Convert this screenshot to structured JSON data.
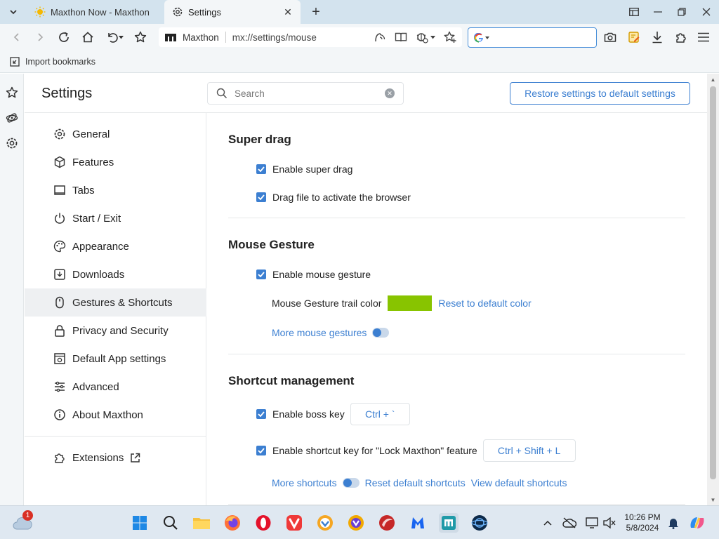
{
  "tabs": [
    {
      "title": "Maxthon Now - Maxthon",
      "active": false
    },
    {
      "title": "Settings",
      "active": true
    }
  ],
  "address": {
    "site": "Maxthon",
    "path": "mx://settings/mouse"
  },
  "search_engine": {
    "value": "",
    "icon": "google-icon"
  },
  "bookmarks_bar": {
    "import_label": "Import bookmarks"
  },
  "settings": {
    "title": "Settings",
    "search_placeholder": "Search",
    "restore_label": "Restore settings to default settings"
  },
  "nav": {
    "items": [
      {
        "label": "General",
        "icon": "gear-icon"
      },
      {
        "label": "Features",
        "icon": "cube-icon"
      },
      {
        "label": "Tabs",
        "icon": "tabs-icon"
      },
      {
        "label": "Start / Exit",
        "icon": "power-icon"
      },
      {
        "label": "Appearance",
        "icon": "palette-icon"
      },
      {
        "label": "Downloads",
        "icon": "download-icon"
      },
      {
        "label": "Gestures & Shortcuts",
        "icon": "gesture-icon",
        "active": true
      },
      {
        "label": "Privacy and Security",
        "icon": "lock-icon"
      },
      {
        "label": "Default App settings",
        "icon": "app-icon"
      },
      {
        "label": "Advanced",
        "icon": "sliders-icon"
      },
      {
        "label": "About Maxthon",
        "icon": "info-icon"
      }
    ],
    "extensions_label": "Extensions"
  },
  "super_drag": {
    "title": "Super drag",
    "enable_label": "Enable super drag",
    "enable_checked": true,
    "drag_file_label": "Drag file to activate the browser",
    "drag_file_checked": true
  },
  "mouse_gesture": {
    "title": "Mouse Gesture",
    "enable_label": "Enable mouse gesture",
    "enable_checked": true,
    "trail_color_label": "Mouse Gesture trail color",
    "trail_color": "#88c400",
    "reset_color_label": "Reset to default color",
    "more_label": "More mouse gestures"
  },
  "shortcuts": {
    "title": "Shortcut management",
    "boss_key_label": "Enable boss key",
    "boss_key_checked": true,
    "boss_key_value": "Ctrl + `",
    "lock_label": "Enable shortcut key for \"Lock Maxthon\" feature",
    "lock_checked": true,
    "lock_value": "Ctrl + Shift + L",
    "more_label": "More shortcuts",
    "reset_label": "Reset default shortcuts",
    "view_label": "View default shortcuts"
  },
  "taskbar": {
    "notification_count": "1",
    "time": "10:26 PM",
    "date": "5/8/2024"
  },
  "colors": {
    "accent": "#3c7fd1",
    "tab_strip": "#d3e3ee"
  }
}
